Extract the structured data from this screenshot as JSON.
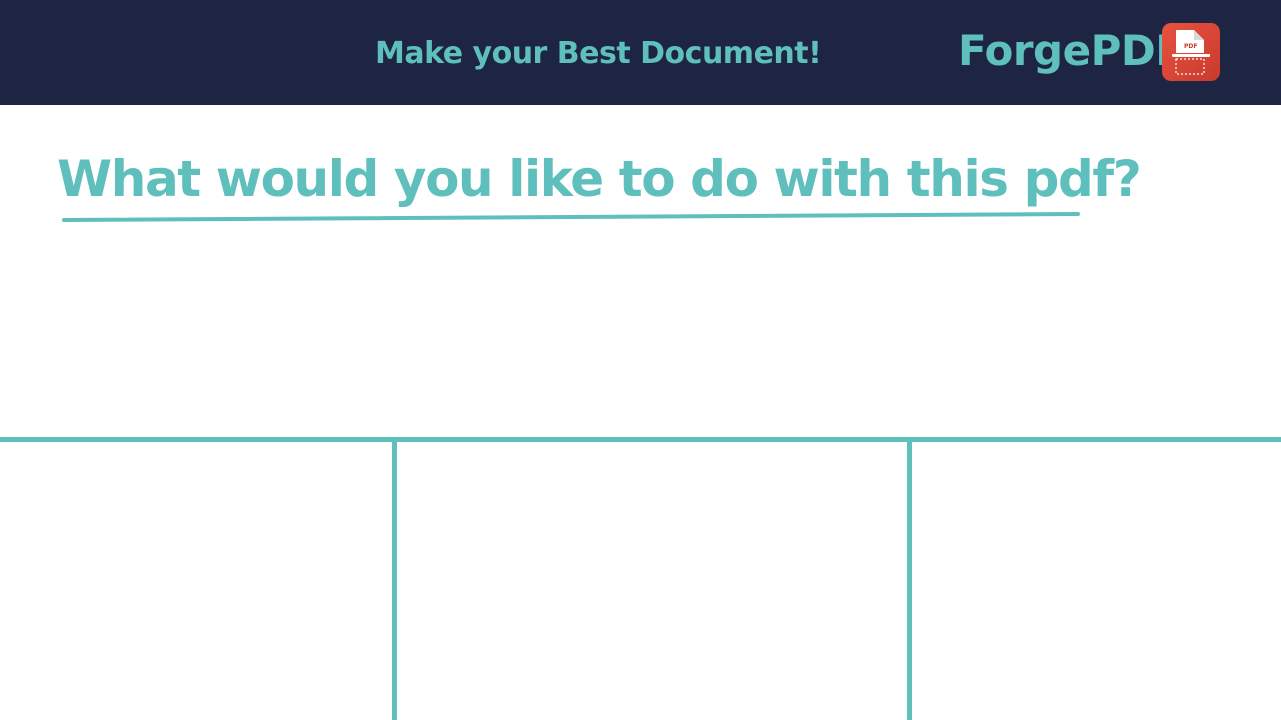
{
  "header": {
    "tagline": "Make your Best Document!",
    "brand_name": "ForgePDF",
    "logo_icon": "pdf-file-icon",
    "logo_label": "PDF",
    "background_color": "#1d2542",
    "accent_color": "#5fbfbd",
    "logo_color": "#e0473a"
  },
  "main": {
    "question": "What would you like to do with this pdf?"
  },
  "options": {
    "panels": [
      "left",
      "middle",
      "right"
    ]
  }
}
